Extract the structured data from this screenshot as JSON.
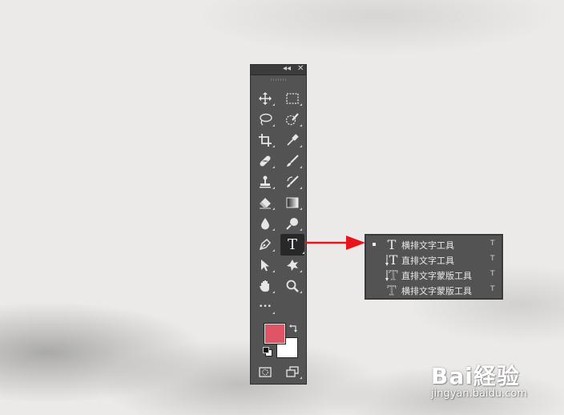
{
  "toolbar": {
    "collapse_glyph": "◂◂",
    "close_glyph": "✕",
    "tools": [
      {
        "name": "move-tool",
        "icon": "move-icon"
      },
      {
        "name": "marquee-tool",
        "icon": "rect-marquee-icon"
      },
      {
        "name": "lasso-tool",
        "icon": "lasso-icon"
      },
      {
        "name": "quick-select-tool",
        "icon": "quick-select-icon"
      },
      {
        "name": "crop-tool",
        "icon": "crop-icon"
      },
      {
        "name": "eyedropper-tool",
        "icon": "eyedropper-icon"
      },
      {
        "name": "healing-tool",
        "icon": "bandage-icon"
      },
      {
        "name": "brush-tool",
        "icon": "brush-icon"
      },
      {
        "name": "stamp-tool",
        "icon": "stamp-icon"
      },
      {
        "name": "history-brush-tool",
        "icon": "history-brush-icon"
      },
      {
        "name": "eraser-tool",
        "icon": "eraser-icon"
      },
      {
        "name": "gradient-tool",
        "icon": "gradient-icon"
      },
      {
        "name": "blur-tool",
        "icon": "drop-icon"
      },
      {
        "name": "dodge-tool",
        "icon": "dodge-icon"
      },
      {
        "name": "pen-tool",
        "icon": "pen-icon"
      },
      {
        "name": "type-tool",
        "icon": "type-icon",
        "glyph": "T"
      },
      {
        "name": "path-select-tool",
        "icon": "arrow-cursor-icon"
      },
      {
        "name": "shape-tool",
        "icon": "custom-shape-icon"
      },
      {
        "name": "hand-tool",
        "icon": "hand-icon"
      },
      {
        "name": "zoom-tool",
        "icon": "magnifier-icon"
      },
      {
        "name": "more-tools",
        "icon": "ellipsis-icon",
        "glyph": "•••"
      }
    ],
    "foreground_color": "#e05565",
    "background_color": "#ffffff"
  },
  "type_menu": {
    "items": [
      {
        "label": "横排文字工具",
        "shortcut": "T",
        "icon": "horizontal-type-icon",
        "selected": true
      },
      {
        "label": "直排文字工具",
        "shortcut": "T",
        "icon": "vertical-type-icon",
        "selected": false
      },
      {
        "label": "直排文字蒙版工具",
        "shortcut": "T",
        "icon": "vertical-type-mask-icon",
        "selected": false
      },
      {
        "label": "横排文字蒙版工具",
        "shortcut": "T",
        "icon": "horizontal-type-mask-icon",
        "selected": false
      }
    ]
  },
  "annotation": {
    "arrow_color": "#e8141c"
  },
  "watermark": {
    "logo": "Bai経验",
    "url": "jingyan.baidu.com"
  }
}
